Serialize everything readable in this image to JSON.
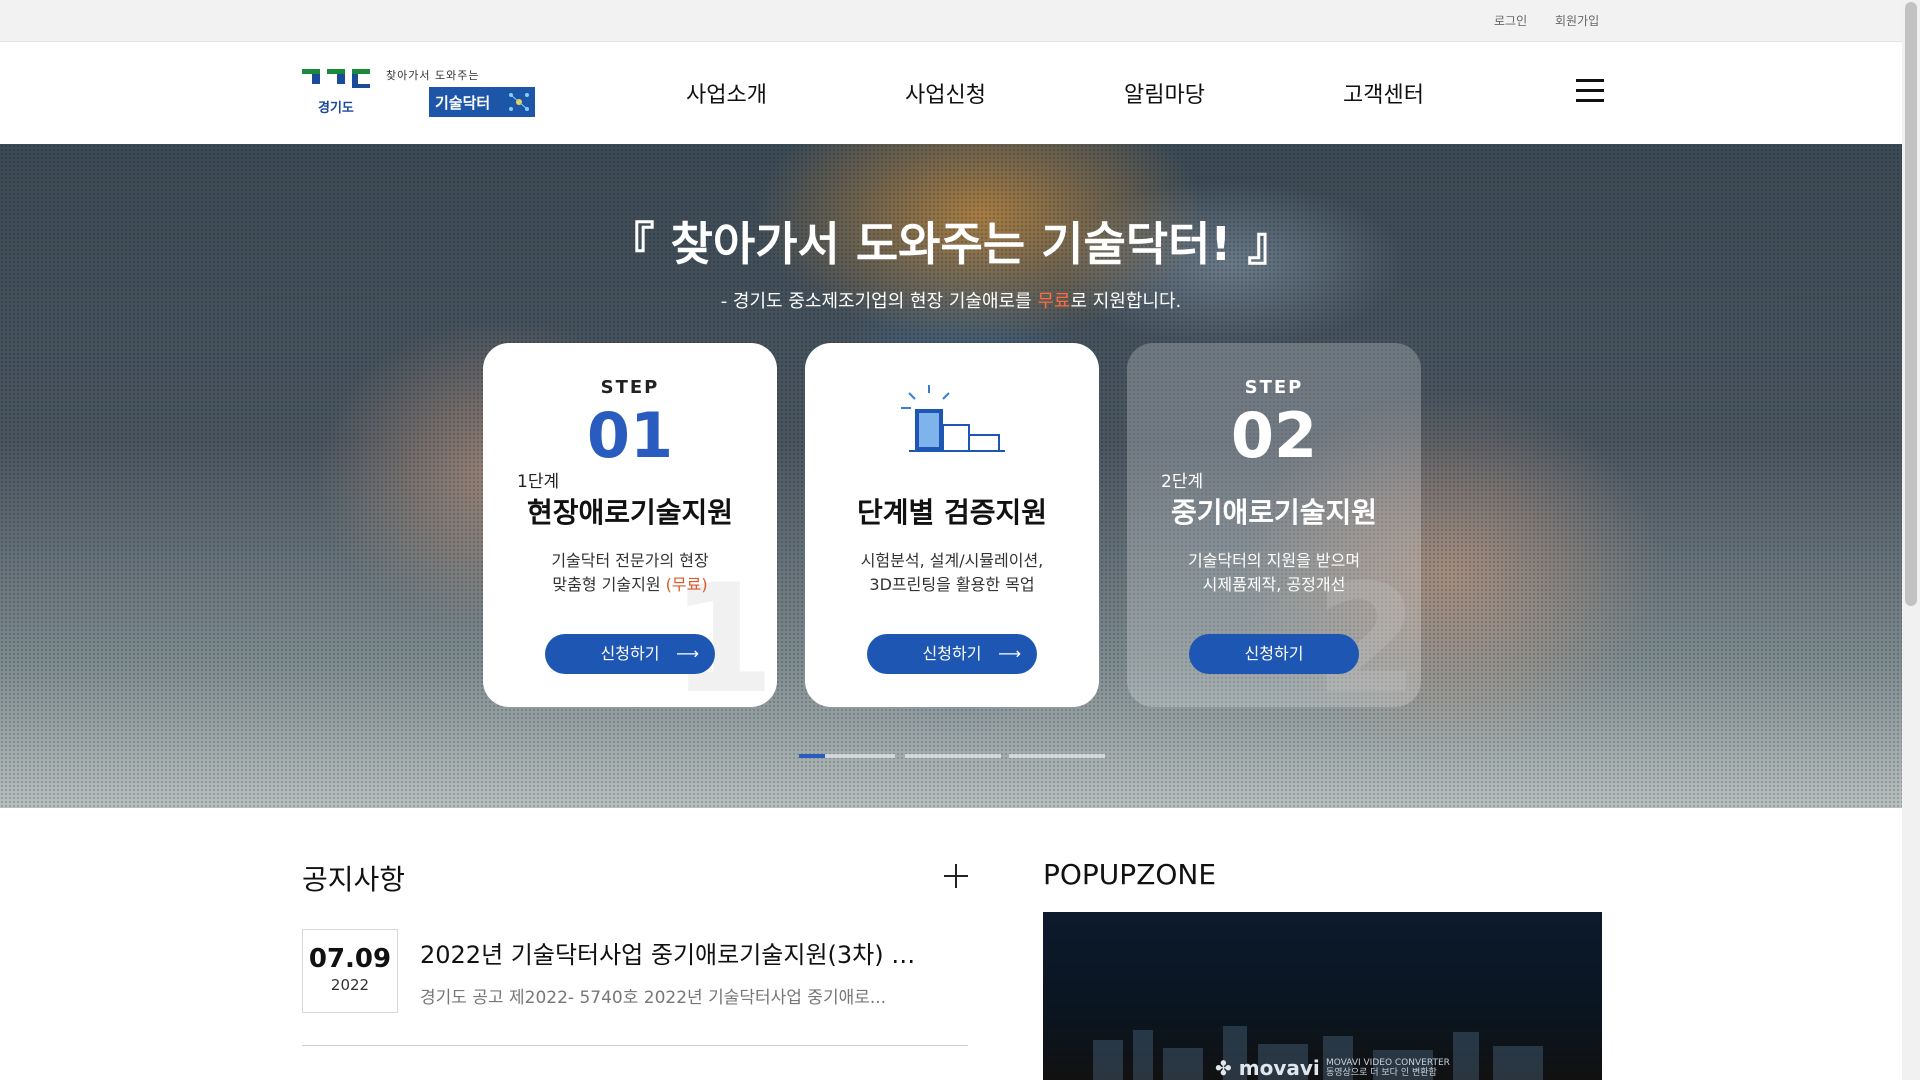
{
  "topbar": {
    "login": "로그인",
    "join": "회원가입"
  },
  "header": {
    "logo": {
      "gov": "경기도",
      "tagline": "찾아가서 도와주는",
      "brand": "기술닥터"
    },
    "nav": [
      "사업소개",
      "사업신청",
      "알림마당",
      "고객센터"
    ],
    "menu_icon": "hamburger-menu-icon"
  },
  "hero": {
    "title": "『 찾아가서 도와주는 기술닥터! 』",
    "subtitle_pre": "- 경기도 중소제조기업의 현장 기술애로를 ",
    "subtitle_free": "무료",
    "subtitle_post": "로 지원합니다.",
    "cards": [
      {
        "step_label": "STEP",
        "step_num": "01",
        "stage": "1단계",
        "title": "현장애로기술지원",
        "desc_line1": "기술닥터 전문가의 현장",
        "desc_line2": "맞춤형 기술지원 ",
        "desc_free": "(무료)",
        "button": "신청하기",
        "bignum": "1"
      },
      {
        "icon": "verification-chart-icon",
        "title": "단계별 검증지원",
        "desc_line1": "시험분석, 설계/시뮬레이션,",
        "desc_line2": "3D프린팅을 활용한 목업",
        "button": "신청하기"
      },
      {
        "step_label": "STEP",
        "step_num": "02",
        "stage": "2단계",
        "title": "중기애로기술지원",
        "desc_line1": "기술닥터의 지원을 받으며",
        "desc_line2": "시제품제작, 공정개선",
        "button": "신청하기",
        "bignum": "2"
      }
    ],
    "active_slide": 1,
    "slide_count": 4
  },
  "notice": {
    "title": "공지사항",
    "more_icon": "plus-icon",
    "items": [
      {
        "date": "07.09",
        "year": "2022",
        "title": "2022년 기술닥터사업 중기애로기술지원(3차) …",
        "summary": "경기도 공고 제2022- 5740호 2022년 기술닥터사업 중기애로..."
      }
    ]
  },
  "popupzone": {
    "title": "POPUPZONE",
    "banner_logo": "movavi",
    "banner_line1": "MOVAVI VIDEO CONVERTER",
    "banner_line2": "동영상으로 더 보다 인 변환함"
  },
  "colors": {
    "brand_blue": "#1e57b3",
    "accent_orange": "#ff6b3d",
    "step_blue": "#2a5cbf"
  }
}
